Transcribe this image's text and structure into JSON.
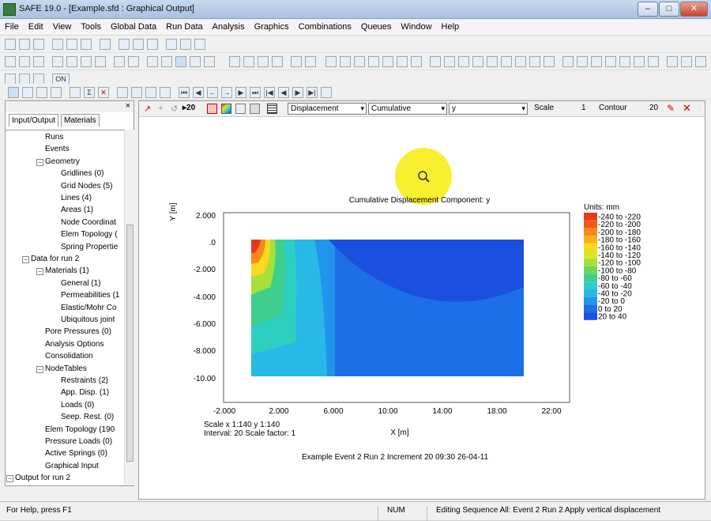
{
  "window": {
    "title": "SAFE 19.0 - [Example.sfd : Graphical Output]"
  },
  "menu": [
    "File",
    "Edit",
    "View",
    "Tools",
    "Global Data",
    "Run Data",
    "Analysis",
    "Graphics",
    "Combinations",
    "Queues",
    "Window",
    "Help"
  ],
  "toolbar3": {
    "on_label": "ON"
  },
  "left_panel": {
    "tabs": [
      "Input/Output",
      "Materials"
    ],
    "tree": [
      {
        "label": "Runs",
        "level": 3
      },
      {
        "label": "Events",
        "level": 3
      },
      {
        "label": "Geometry",
        "level": 3,
        "expander": "−"
      },
      {
        "label": "Gridlines (0)",
        "level": 4
      },
      {
        "label": "Grid Nodes (5)",
        "level": 4
      },
      {
        "label": "Lines (4)",
        "level": 4
      },
      {
        "label": "Areas (1)",
        "level": 4
      },
      {
        "label": "Node Coordinat",
        "level": 4
      },
      {
        "label": "Elem Topology (",
        "level": 4
      },
      {
        "label": "Spring Propertie",
        "level": 4
      },
      {
        "label": "Data for run 2",
        "level": 2,
        "expander": "−"
      },
      {
        "label": "Materials (1)",
        "level": 3,
        "expander": "−"
      },
      {
        "label": "General (1)",
        "level": 4
      },
      {
        "label": "Permeabilities (1",
        "level": 4
      },
      {
        "label": "Elastic/Mohr Co",
        "level": 4
      },
      {
        "label": "Ubiquitous joint",
        "level": 4
      },
      {
        "label": "Pore Pressures (0)",
        "level": 3
      },
      {
        "label": "Analysis Options",
        "level": 3
      },
      {
        "label": "Consolidation",
        "level": 3
      },
      {
        "label": "NodeTables",
        "level": 3,
        "expander": "−"
      },
      {
        "label": "Restraints (2)",
        "level": 4
      },
      {
        "label": "App. Disp. (1)",
        "level": 4
      },
      {
        "label": "Loads (0)",
        "level": 4
      },
      {
        "label": "Seep. Rest. (0)",
        "level": 4
      },
      {
        "label": "Elem Topology (190",
        "level": 3
      },
      {
        "label": "Pressure Loads (0)",
        "level": 3
      },
      {
        "label": "Active Springs (0)",
        "level": 3
      },
      {
        "label": "Graphical Input",
        "level": 3
      },
      {
        "label": "Output for run 2",
        "level": 1,
        "expander": "−"
      }
    ]
  },
  "graph_toolbar": {
    "quantity": "Displacement",
    "mode": "Cumulative",
    "component": "y",
    "scale_label": "Scale",
    "scale_value": "1",
    "contour_label": "Contour",
    "contour_value": "20"
  },
  "plot": {
    "title": "Cumulative Displacement   Component: y",
    "y_axis_label": "Y [m]",
    "x_axis_label": "X [m]",
    "y_ticks": [
      "2.000",
      ".0",
      "-2.000",
      "-4.000",
      "-6.000",
      "-8.000",
      "-10.00"
    ],
    "x_ticks": [
      "-2.000",
      "2.000",
      "6.000",
      "10:00",
      "14:00",
      "18:00",
      "22:00"
    ],
    "scale_text": "Scale x 1:140  y 1:140",
    "interval_text": "Interval: 20  Scale factor:  1",
    "footer": "Example  Event 2 Run 2  Increment 20 09:30 26-04-11",
    "legend_title": "Units: mm",
    "legend": [
      {
        "label": "-240 to -220",
        "color": "#e63a1f"
      },
      {
        "label": "-220 to -200",
        "color": "#f05a1c"
      },
      {
        "label": "-200 to -180",
        "color": "#f5891a"
      },
      {
        "label": "-180 to -160",
        "color": "#f8b01b"
      },
      {
        "label": "-160 to -140",
        "color": "#f7d920"
      },
      {
        "label": "-140 to -120",
        "color": "#d9e825"
      },
      {
        "label": "-120 to -100",
        "color": "#a7e03a"
      },
      {
        "label": "-100 to -80",
        "color": "#6fd65a"
      },
      {
        "label": "-80 to -60",
        "color": "#3fcf8c"
      },
      {
        "label": "-60 to -40",
        "color": "#2ecfc0"
      },
      {
        "label": "-40 to -20",
        "color": "#28b9e6"
      },
      {
        "label": "-20 to 0",
        "color": "#2294ec"
      },
      {
        "label": "0 to 20",
        "color": "#1d6fe8"
      },
      {
        "label": "20 to 40",
        "color": "#1a4fe0"
      }
    ]
  },
  "status": {
    "help": "For Help, press F1",
    "num": "NUM",
    "editing": "Editing Sequence All: Event 2 Run 2 Apply vertical displacement"
  }
}
